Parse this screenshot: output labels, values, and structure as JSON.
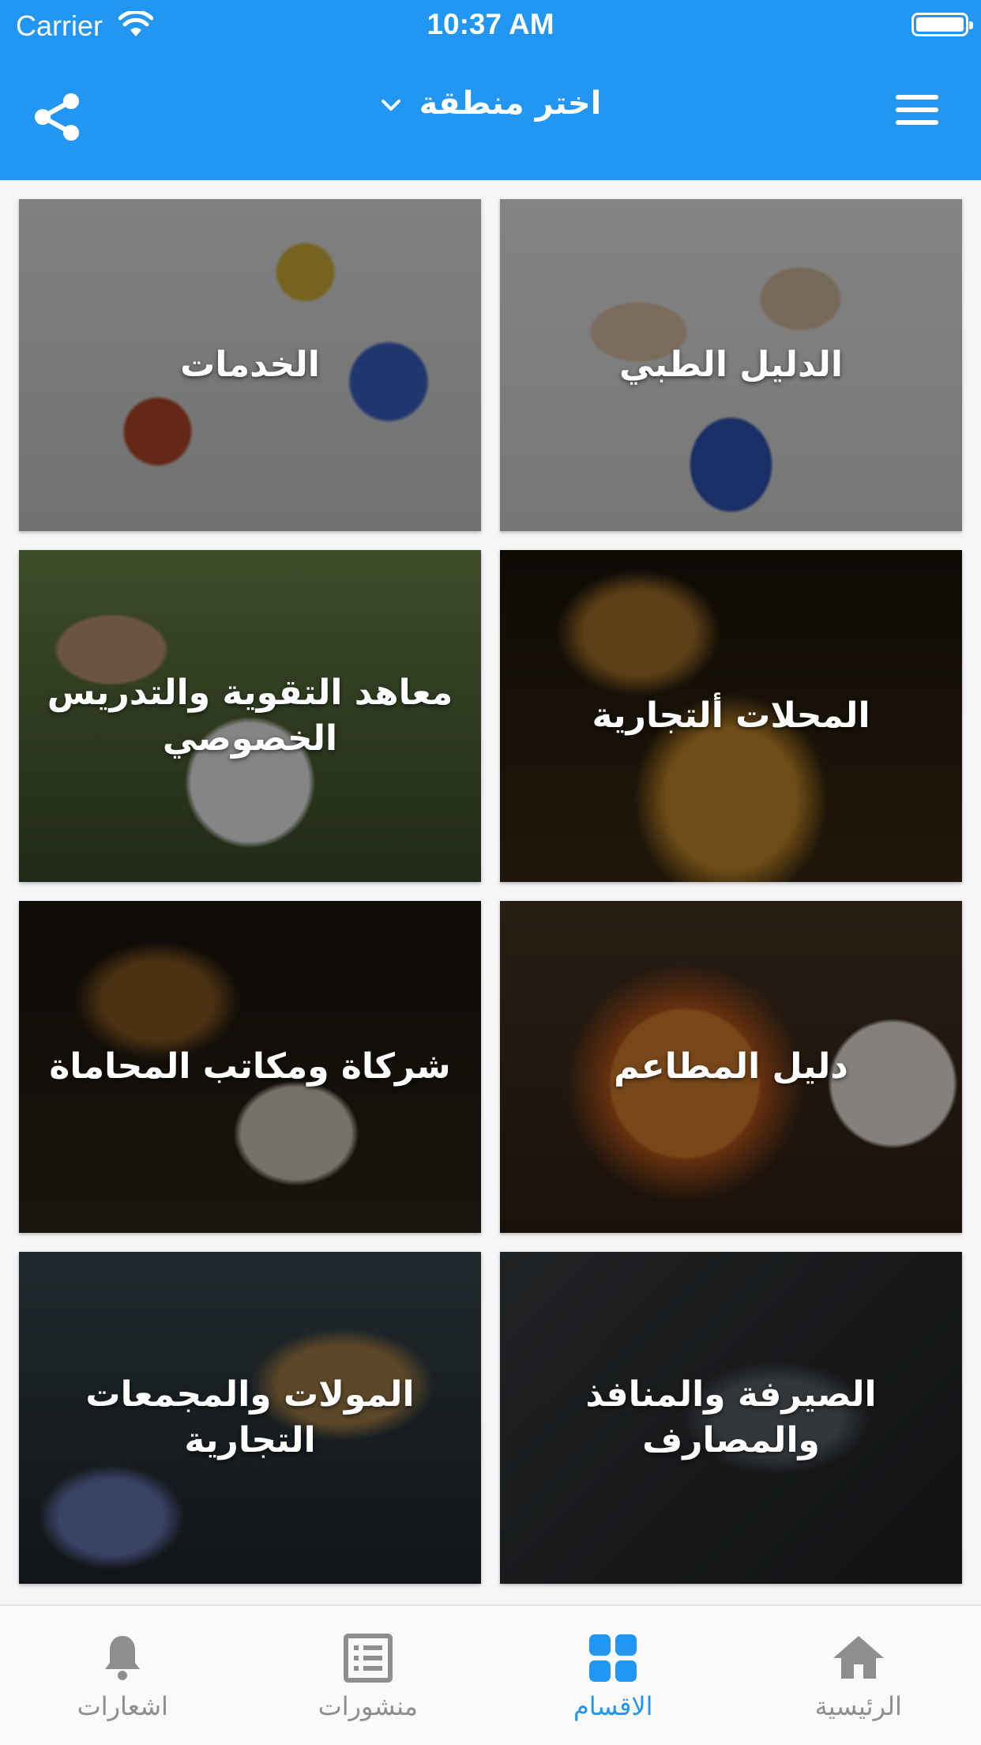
{
  "status_bar": {
    "carrier": "Carrier",
    "time": "10:37 AM"
  },
  "nav": {
    "region_label": "اختر منطقة",
    "share_icon": "share-icon",
    "menu_icon": "hamburger-menu-icon"
  },
  "categories": [
    {
      "label": "الدليل الطبي",
      "image": "medical-staff-photo"
    },
    {
      "label": "الخدمات",
      "image": "cleaning-supplies-photo"
    },
    {
      "label": "المحلات ألتجارية",
      "image": "illuminated-shopping-street-photo"
    },
    {
      "label": "معاهد التقوية والتدريس الخصوصي",
      "image": "students-studying-photo"
    },
    {
      "label": "دليل المطاعم",
      "image": "restaurant-food-photo"
    },
    {
      "label": "شركاة ومكاتب المحاماة",
      "image": "scales-of-justice-photo"
    },
    {
      "label": "الصيرفة والمنافذ والمصارف",
      "image": "bank-building-photo"
    },
    {
      "label": "المولات والمجمعات التجارية",
      "image": "mall-interior-photo"
    }
  ],
  "tabs": [
    {
      "label": "الرئيسية",
      "icon": "home-icon",
      "active": false
    },
    {
      "label": "الاقسام",
      "icon": "grid-icon",
      "active": true
    },
    {
      "label": "منشورات",
      "icon": "list-icon",
      "active": false
    },
    {
      "label": "اشعارات",
      "icon": "bell-icon",
      "active": false
    }
  ],
  "colors": {
    "primary": "#2196f3",
    "tab_inactive": "#8e8e8e",
    "background": "#f5f5f7"
  }
}
